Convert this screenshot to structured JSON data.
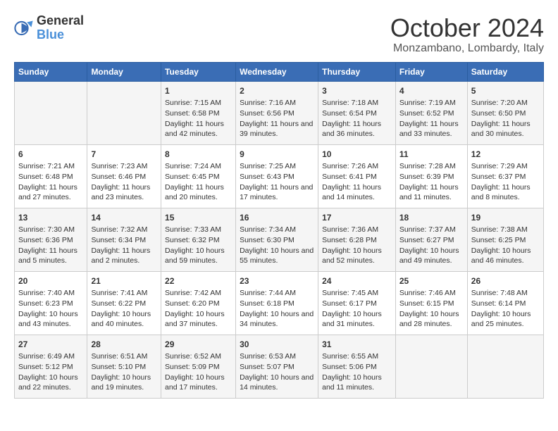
{
  "header": {
    "logo_line1": "General",
    "logo_line2": "Blue",
    "month": "October 2024",
    "location": "Monzambano, Lombardy, Italy"
  },
  "days_of_week": [
    "Sunday",
    "Monday",
    "Tuesday",
    "Wednesday",
    "Thursday",
    "Friday",
    "Saturday"
  ],
  "weeks": [
    [
      {
        "day": "",
        "content": ""
      },
      {
        "day": "",
        "content": ""
      },
      {
        "day": "1",
        "content": "Sunrise: 7:15 AM\nSunset: 6:58 PM\nDaylight: 11 hours and 42 minutes."
      },
      {
        "day": "2",
        "content": "Sunrise: 7:16 AM\nSunset: 6:56 PM\nDaylight: 11 hours and 39 minutes."
      },
      {
        "day": "3",
        "content": "Sunrise: 7:18 AM\nSunset: 6:54 PM\nDaylight: 11 hours and 36 minutes."
      },
      {
        "day": "4",
        "content": "Sunrise: 7:19 AM\nSunset: 6:52 PM\nDaylight: 11 hours and 33 minutes."
      },
      {
        "day": "5",
        "content": "Sunrise: 7:20 AM\nSunset: 6:50 PM\nDaylight: 11 hours and 30 minutes."
      }
    ],
    [
      {
        "day": "6",
        "content": "Sunrise: 7:21 AM\nSunset: 6:48 PM\nDaylight: 11 hours and 27 minutes."
      },
      {
        "day": "7",
        "content": "Sunrise: 7:23 AM\nSunset: 6:46 PM\nDaylight: 11 hours and 23 minutes."
      },
      {
        "day": "8",
        "content": "Sunrise: 7:24 AM\nSunset: 6:45 PM\nDaylight: 11 hours and 20 minutes."
      },
      {
        "day": "9",
        "content": "Sunrise: 7:25 AM\nSunset: 6:43 PM\nDaylight: 11 hours and 17 minutes."
      },
      {
        "day": "10",
        "content": "Sunrise: 7:26 AM\nSunset: 6:41 PM\nDaylight: 11 hours and 14 minutes."
      },
      {
        "day": "11",
        "content": "Sunrise: 7:28 AM\nSunset: 6:39 PM\nDaylight: 11 hours and 11 minutes."
      },
      {
        "day": "12",
        "content": "Sunrise: 7:29 AM\nSunset: 6:37 PM\nDaylight: 11 hours and 8 minutes."
      }
    ],
    [
      {
        "day": "13",
        "content": "Sunrise: 7:30 AM\nSunset: 6:36 PM\nDaylight: 11 hours and 5 minutes."
      },
      {
        "day": "14",
        "content": "Sunrise: 7:32 AM\nSunset: 6:34 PM\nDaylight: 11 hours and 2 minutes."
      },
      {
        "day": "15",
        "content": "Sunrise: 7:33 AM\nSunset: 6:32 PM\nDaylight: 10 hours and 59 minutes."
      },
      {
        "day": "16",
        "content": "Sunrise: 7:34 AM\nSunset: 6:30 PM\nDaylight: 10 hours and 55 minutes."
      },
      {
        "day": "17",
        "content": "Sunrise: 7:36 AM\nSunset: 6:28 PM\nDaylight: 10 hours and 52 minutes."
      },
      {
        "day": "18",
        "content": "Sunrise: 7:37 AM\nSunset: 6:27 PM\nDaylight: 10 hours and 49 minutes."
      },
      {
        "day": "19",
        "content": "Sunrise: 7:38 AM\nSunset: 6:25 PM\nDaylight: 10 hours and 46 minutes."
      }
    ],
    [
      {
        "day": "20",
        "content": "Sunrise: 7:40 AM\nSunset: 6:23 PM\nDaylight: 10 hours and 43 minutes."
      },
      {
        "day": "21",
        "content": "Sunrise: 7:41 AM\nSunset: 6:22 PM\nDaylight: 10 hours and 40 minutes."
      },
      {
        "day": "22",
        "content": "Sunrise: 7:42 AM\nSunset: 6:20 PM\nDaylight: 10 hours and 37 minutes."
      },
      {
        "day": "23",
        "content": "Sunrise: 7:44 AM\nSunset: 6:18 PM\nDaylight: 10 hours and 34 minutes."
      },
      {
        "day": "24",
        "content": "Sunrise: 7:45 AM\nSunset: 6:17 PM\nDaylight: 10 hours and 31 minutes."
      },
      {
        "day": "25",
        "content": "Sunrise: 7:46 AM\nSunset: 6:15 PM\nDaylight: 10 hours and 28 minutes."
      },
      {
        "day": "26",
        "content": "Sunrise: 7:48 AM\nSunset: 6:14 PM\nDaylight: 10 hours and 25 minutes."
      }
    ],
    [
      {
        "day": "27",
        "content": "Sunrise: 6:49 AM\nSunset: 5:12 PM\nDaylight: 10 hours and 22 minutes."
      },
      {
        "day": "28",
        "content": "Sunrise: 6:51 AM\nSunset: 5:10 PM\nDaylight: 10 hours and 19 minutes."
      },
      {
        "day": "29",
        "content": "Sunrise: 6:52 AM\nSunset: 5:09 PM\nDaylight: 10 hours and 17 minutes."
      },
      {
        "day": "30",
        "content": "Sunrise: 6:53 AM\nSunset: 5:07 PM\nDaylight: 10 hours and 14 minutes."
      },
      {
        "day": "31",
        "content": "Sunrise: 6:55 AM\nSunset: 5:06 PM\nDaylight: 10 hours and 11 minutes."
      },
      {
        "day": "",
        "content": ""
      },
      {
        "day": "",
        "content": ""
      }
    ]
  ]
}
